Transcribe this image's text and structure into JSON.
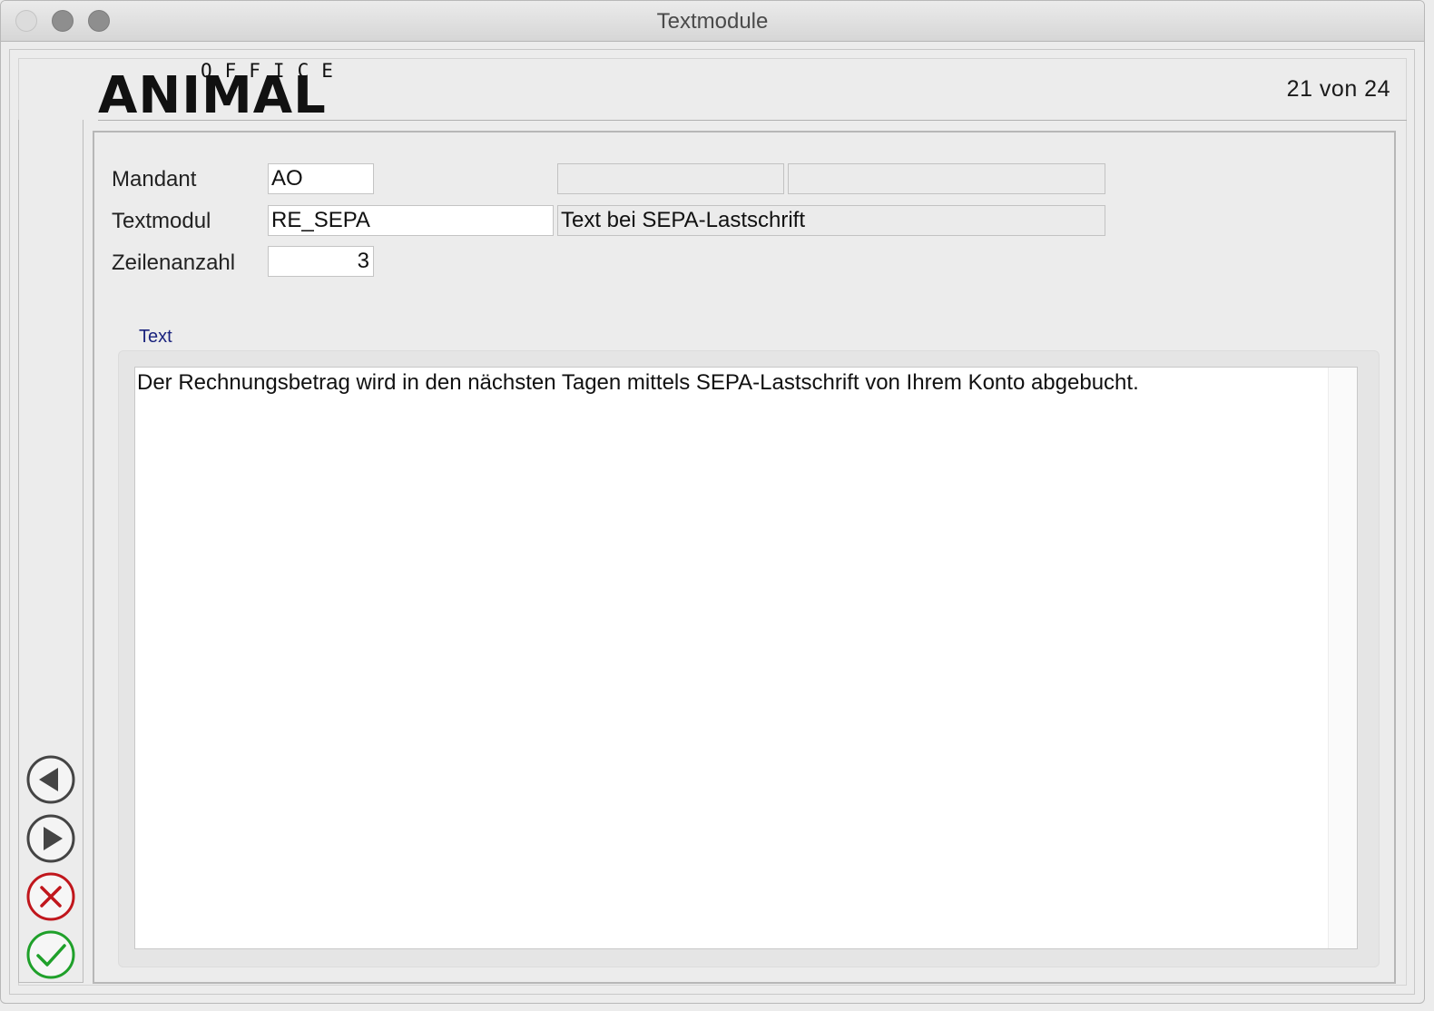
{
  "window": {
    "title": "Textmodule"
  },
  "logo": {
    "top": "OFFICE",
    "main": "ANIMAL"
  },
  "record_count": "21 von 24",
  "form": {
    "mandant": {
      "label": "Mandant",
      "value": "AO",
      "desc1": "",
      "desc2": ""
    },
    "textmodul": {
      "label": "Textmodul",
      "value": "RE_SEPA",
      "description": "Text bei SEPA-Lastschrift"
    },
    "zeilenanzahl": {
      "label": "Zeilenanzahl",
      "value": "3"
    }
  },
  "text_section": {
    "label": "Text",
    "content": "Der Rechnungsbetrag wird in den nächsten Tagen mittels SEPA-Lastschrift von Ihrem Konto abgebucht."
  },
  "nav": {
    "previous_icon": "triangle-left-icon",
    "next_icon": "triangle-right-icon",
    "cancel_icon": "x-circle-icon",
    "confirm_icon": "checkmark-circle-icon"
  },
  "colors": {
    "cancel": "#c0161c",
    "confirm": "#1fa02a",
    "nav": "#444444",
    "section_label": "#1a237e"
  }
}
